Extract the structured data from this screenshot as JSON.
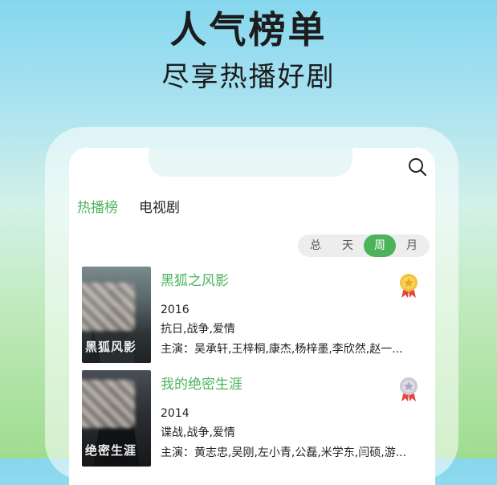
{
  "hero": {
    "title": "人气榜单",
    "subtitle": "尽享热播好剧"
  },
  "tabs": [
    {
      "label": "热播榜",
      "active": true
    },
    {
      "label": "电视剧",
      "active": false
    }
  ],
  "period_selector": {
    "options": [
      "总",
      "天",
      "周",
      "月"
    ],
    "selected": "周"
  },
  "items": [
    {
      "rank_medal": "gold-medal-icon",
      "poster_text": "黑狐风影",
      "title": "黑狐之风影",
      "year": "2016",
      "genres": "抗日,战争,爱情",
      "cast": "主演：吴承轩,王梓桐,康杰,杨梓墨,李欣然,赵一..."
    },
    {
      "rank_medal": "silver-medal-icon",
      "poster_text": "绝密生涯",
      "title": "我的绝密生涯",
      "year": "2014",
      "genres": "谍战,战争,爱情",
      "cast": "主演：黄志忠,吴刚,左小青,公磊,米学东,闫硕,游..."
    }
  ],
  "colors": {
    "accent": "#4cb35c",
    "gold": "#f2c23a",
    "silver": "#c9c9d6",
    "ribbon": "#e6463b"
  }
}
